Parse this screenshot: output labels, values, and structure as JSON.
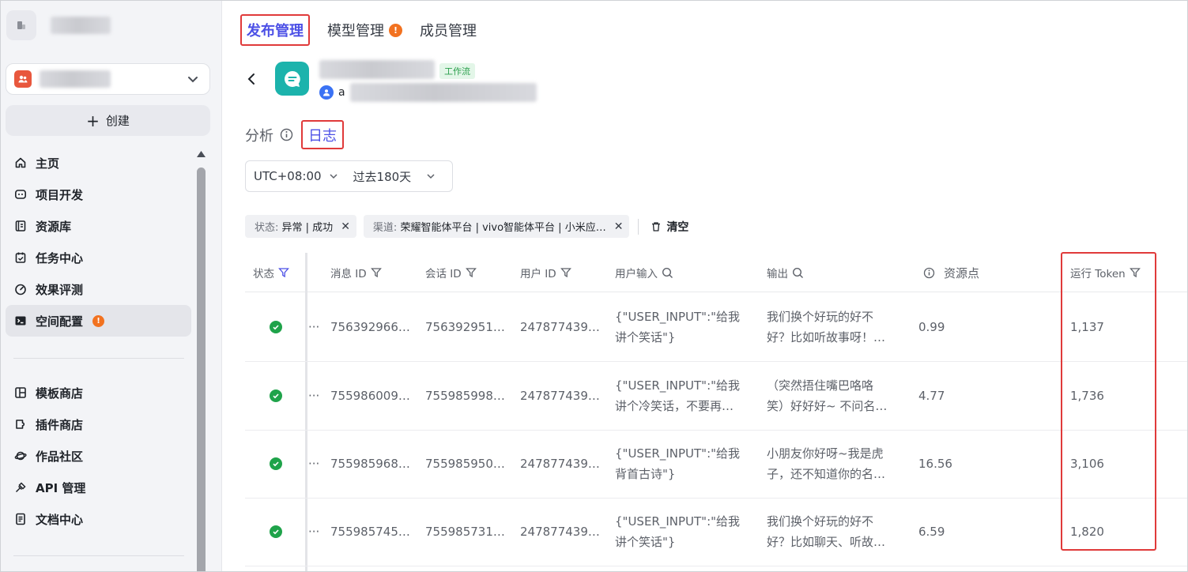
{
  "sidebar": {
    "create_label": "创建",
    "nav_main": [
      {
        "label": "主页",
        "icon": "home-icon"
      },
      {
        "label": "项目开发",
        "icon": "bot-icon"
      },
      {
        "label": "资源库",
        "icon": "library-icon"
      },
      {
        "label": "任务中心",
        "icon": "task-icon"
      },
      {
        "label": "效果评测",
        "icon": "gauge-icon"
      },
      {
        "label": "空间配置",
        "icon": "terminal-icon",
        "badge": "!"
      }
    ],
    "nav_secondary": [
      {
        "label": "模板商店",
        "icon": "template-icon"
      },
      {
        "label": "插件商店",
        "icon": "plugin-icon"
      },
      {
        "label": "作品社区",
        "icon": "planet-icon"
      },
      {
        "label": "API 管理",
        "icon": "api-icon"
      },
      {
        "label": "文档中心",
        "icon": "doc-icon"
      }
    ]
  },
  "top_tabs": [
    {
      "label": "发布管理",
      "active": true
    },
    {
      "label": "模型管理",
      "badge": "!"
    },
    {
      "label": "成员管理"
    }
  ],
  "app": {
    "tag": "工作流",
    "owner_initial": "a"
  },
  "sub_tabs": {
    "analysis": "分析",
    "logs": "日志"
  },
  "filters": {
    "timezone": "UTC+08:00",
    "range": "过去180天"
  },
  "chips": [
    {
      "key": "状态:",
      "value": "异常 | 成功"
    },
    {
      "key": "渠道:",
      "value": "荣耀智能体平台 | vivo智能体平台 | 小米应…"
    }
  ],
  "clear_label": "清空",
  "table": {
    "headers": {
      "status": "状态",
      "message_id": "消息 ID",
      "session_id": "会话 ID",
      "user_id": "用户 ID",
      "user_input": "用户输入",
      "output": "输出",
      "resource": "资源点",
      "token": "运行 Token"
    },
    "rows": [
      {
        "message_id": "756392966…",
        "session_id": "756392951…",
        "user_id": "247877439…",
        "input_1": "{\"USER_INPUT\":\"给我",
        "input_2": "讲个笑话\"}",
        "output_1": "我们换个好玩的好不",
        "output_2": "好？比如听故事呀！…",
        "resource": "0.99",
        "token": "1,137"
      },
      {
        "message_id": "755986009…",
        "session_id": "755985998…",
        "user_id": "247877439…",
        "input_1": "{\"USER_INPUT\":\"给我",
        "input_2": "讲个冷笑话，不要再…",
        "output_1": "（突然捂住嘴巴咯咯",
        "output_2": "笑）好好好~ 不问名…",
        "resource": "4.77",
        "token": "1,736"
      },
      {
        "message_id": "755985968…",
        "session_id": "755985950…",
        "user_id": "247877439…",
        "input_1": "{\"USER_INPUT\":\"给我",
        "input_2": "背首古诗\"}",
        "output_1": "小朋友你好呀~我是虎",
        "output_2": "子，还不知道你的名…",
        "resource": "16.56",
        "token": "3,106"
      },
      {
        "message_id": "755985745…",
        "session_id": "755985731…",
        "user_id": "247877439…",
        "input_1": "{\"USER_INPUT\":\"给我",
        "input_2": "讲个笑话\"}",
        "output_1": "我们换个好玩的好不",
        "output_2": "好？比如聊天、听故…",
        "resource": "6.59",
        "token": "1,820"
      }
    ]
  },
  "colors": {
    "accent": "#4c50e6",
    "highlight_border": "#e03a3a",
    "success": "#1fa34a",
    "badge": "#f27220",
    "app_icon": "#1cb3ac"
  }
}
